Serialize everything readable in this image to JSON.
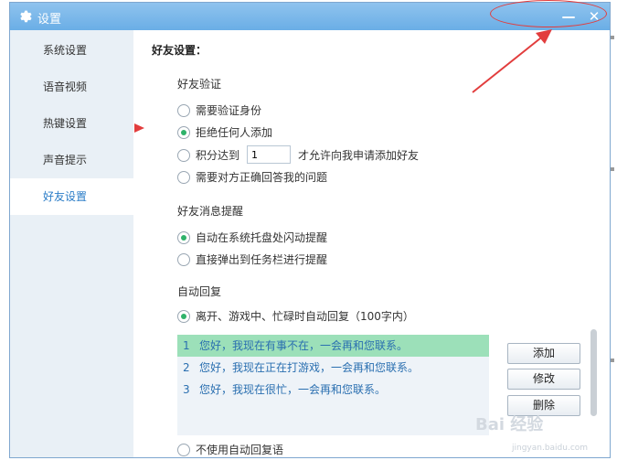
{
  "window": {
    "title": "设置",
    "minimize_glyph": "—",
    "close_glyph": "✕",
    "title_icon": "gear-icon"
  },
  "sidebar": {
    "items": [
      {
        "label": "系统设置",
        "active": false
      },
      {
        "label": "语音视频",
        "active": false
      },
      {
        "label": "热键设置",
        "active": false
      },
      {
        "label": "声音提示",
        "active": false
      },
      {
        "label": "好友设置",
        "active": true
      }
    ]
  },
  "content": {
    "heading": "好友设置：",
    "verification": {
      "title": "好友验证",
      "options": [
        {
          "label": "需要验证身份",
          "checked": false
        },
        {
          "label": "拒绝任何人添加",
          "checked": true
        },
        {
          "label": "积分达到",
          "checked": false
        },
        {
          "label": "需要对方正确回答我的问题",
          "checked": false
        }
      ],
      "score_value": "1",
      "score_suffix": "才允许向我申请添加好友"
    },
    "message_reminder": {
      "title": "好友消息提醒",
      "options": [
        {
          "label": "自动在系统托盘处闪动提醒",
          "checked": true
        },
        {
          "label": "直接弹出到任务栏进行提醒",
          "checked": false
        }
      ]
    },
    "auto_reply": {
      "title": "自动回复",
      "enable_label": "离开、游戏中、忙碌时自动回复（100字内）",
      "enable_checked": true,
      "replies": [
        {
          "num": "1",
          "text": "您好，我现在有事不在，一会再和您联系。",
          "selected": true
        },
        {
          "num": "2",
          "text": "您好，我现在正在打游戏，一会再和您联系。",
          "selected": false
        },
        {
          "num": "3",
          "text": "您好，我现在很忙，一会再和您联系。",
          "selected": false
        }
      ],
      "buttons": {
        "add": "添加",
        "edit": "修改",
        "delete": "删除"
      },
      "disable_label": "不使用自动回复语",
      "disable_checked": false
    }
  },
  "watermark": {
    "text": "Bai 经验",
    "sub": "jingyan.baidu.com"
  },
  "colors": {
    "titlebar": "#7db8ea",
    "sidebar_bg": "#e9f0f6",
    "active_text": "#2a7cc7",
    "radio_checked": "#2fb26a",
    "selected_row": "#9ce0b9",
    "annotation_red": "#e23d3d"
  }
}
